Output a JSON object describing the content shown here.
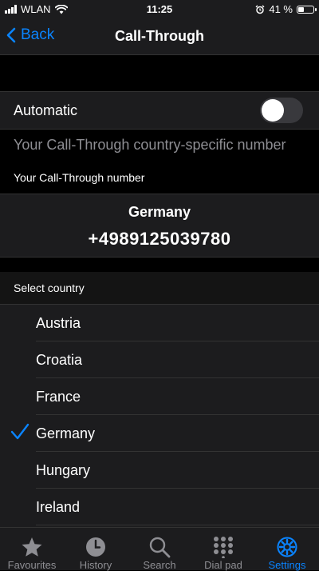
{
  "status": {
    "carrier": "WLAN",
    "time": "11:25",
    "battery": "41 %",
    "battery_level": 0.41
  },
  "nav": {
    "back_label": "Back",
    "title": "Call-Through"
  },
  "automatic": {
    "label": "Automatic",
    "enabled": false
  },
  "placeholder_text": "Your Call-Through country-specific number",
  "number_section_label": "Your Call-Through number",
  "current": {
    "country": "Germany",
    "number": "+4989125039780"
  },
  "select_country_label": "Select country",
  "countries": [
    {
      "name": "Austria",
      "selected": false
    },
    {
      "name": "Croatia",
      "selected": false
    },
    {
      "name": "France",
      "selected": false
    },
    {
      "name": "Germany",
      "selected": true
    },
    {
      "name": "Hungary",
      "selected": false
    },
    {
      "name": "Ireland",
      "selected": false
    }
  ],
  "tabs": [
    {
      "label": "Favourites",
      "icon": "star-icon",
      "active": false
    },
    {
      "label": "History",
      "icon": "clock-icon",
      "active": false
    },
    {
      "label": "Search",
      "icon": "search-icon",
      "active": false
    },
    {
      "label": "Dial pad",
      "icon": "dialpad-icon",
      "active": false
    },
    {
      "label": "Settings",
      "icon": "gear-icon",
      "active": true
    }
  ],
  "colors": {
    "accent": "#0a84ff",
    "background": "#000000",
    "cell": "#1c1c1e",
    "secondary_text": "#8e8e93"
  }
}
